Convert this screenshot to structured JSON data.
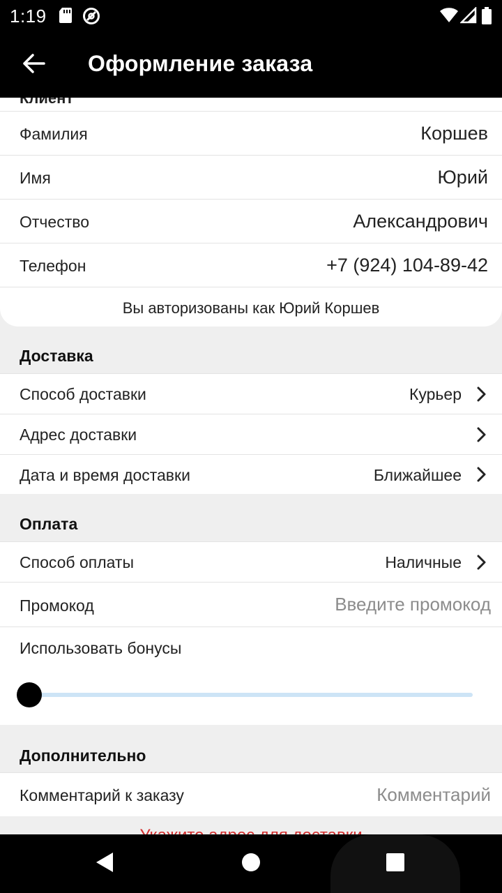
{
  "status_bar": {
    "time": "1:19"
  },
  "app_bar": {
    "title": "Оформление заказа"
  },
  "client": {
    "clipped_header": "Клиент",
    "fields": [
      {
        "label": "Фамилия",
        "value": "Коршев"
      },
      {
        "label": "Имя",
        "value": "Юрий"
      },
      {
        "label": "Отчество",
        "value": "Александрович"
      },
      {
        "label": "Телефон",
        "value": "+7 (924) 104-89-42"
      }
    ],
    "auth_note": "Вы авторизованы как Юрий Коршев"
  },
  "delivery": {
    "title": "Доставка",
    "rows": [
      {
        "label": "Способ доставки",
        "value": "Курьер"
      },
      {
        "label": "Адрес доставки",
        "value": ""
      },
      {
        "label": "Дата и время доставки",
        "value": "Ближайшее"
      }
    ]
  },
  "payment": {
    "title": "Оплата",
    "method_label": "Способ оплаты",
    "method_value": "Наличные",
    "promo_label": "Промокод",
    "promo_placeholder": "Введите промокод",
    "bonus_label": "Использовать бонусы",
    "bonus_slider_value": 0
  },
  "additional": {
    "title": "Дополнительно",
    "comment_label": "Комментарий к заказу",
    "comment_placeholder": "Комментарий"
  },
  "warning": "Укажите адрес для доставки",
  "colors": {
    "bar": "#000000",
    "background": "#efefef",
    "card": "#ffffff",
    "slider_track": "#cde4f6",
    "warning": "#d32f2f"
  },
  "icons": [
    "sd-card-icon",
    "no-disturb-icon",
    "wifi-icon",
    "cell-signal-icon",
    "battery-icon",
    "back-arrow-icon",
    "chevron-right-icon",
    "nav-back-icon",
    "nav-home-icon",
    "nav-recents-icon"
  ]
}
